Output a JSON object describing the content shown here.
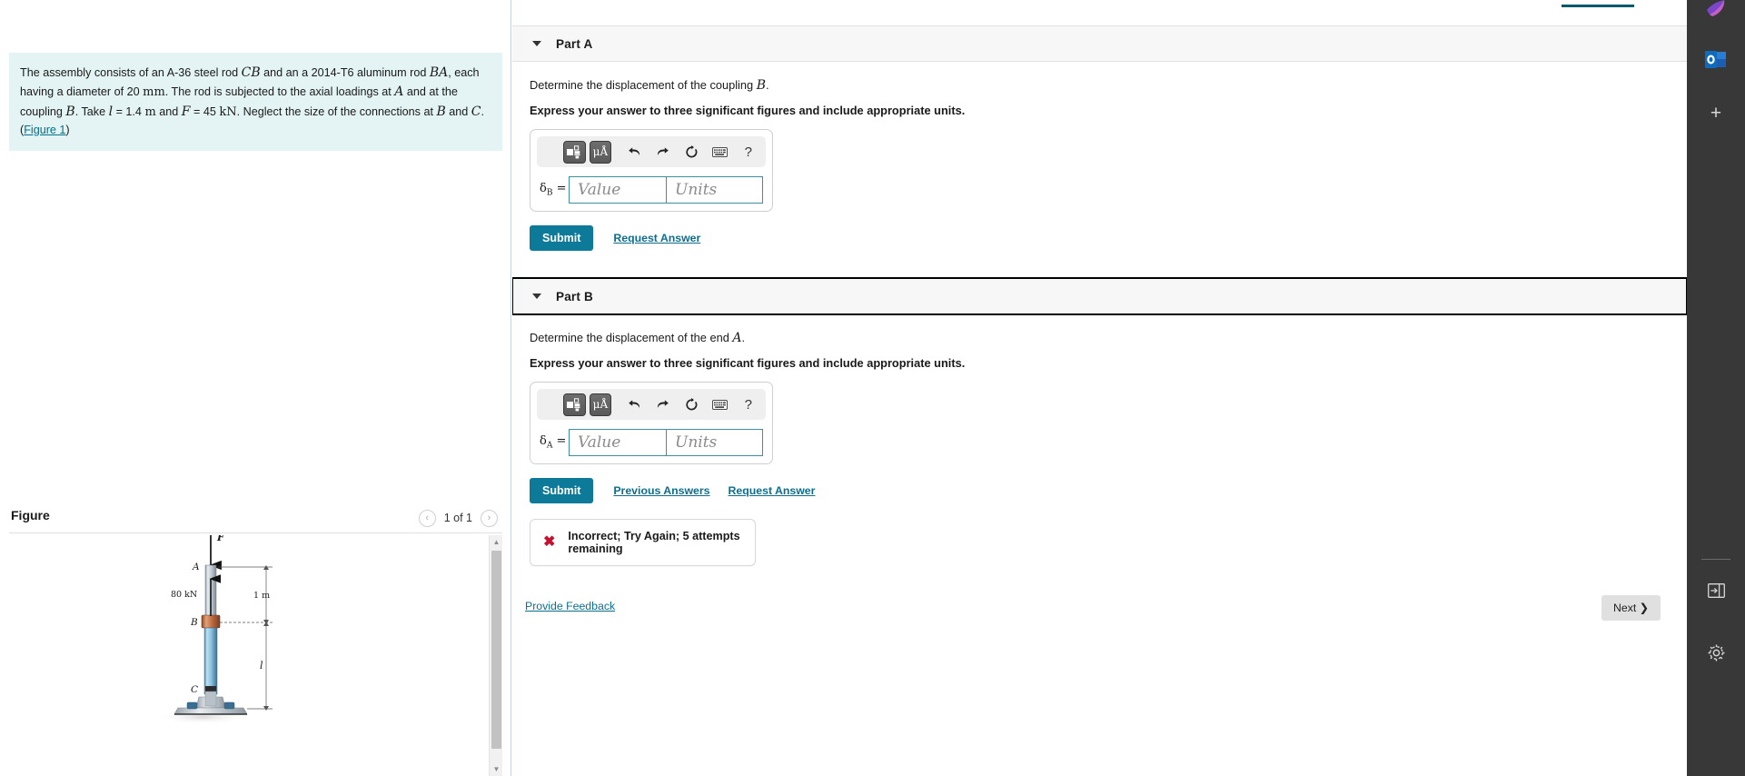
{
  "problem": {
    "text_1": "The assembly consists of an A-36 steel rod ",
    "rod_cb": "CB",
    "text_2": " and an a 2014-T6 aluminum rod ",
    "rod_ba": "BA",
    "text_3": ", each having a diameter of 20 ",
    "unit_mm": "mm",
    "text_4": ". The rod is subjected to the axial loadings at ",
    "point_a": "A",
    "text_5": " and at the coupling ",
    "point_b": "B",
    "text_6": ". Take ",
    "var_l": "l",
    "text_7": " = 1.4 ",
    "unit_m": "m",
    "text_8": " and ",
    "var_f": "F",
    "text_9": " = 45 ",
    "unit_kn": "kN",
    "text_10": ". Neglect the size of the connections at ",
    "point_b2": "B",
    "text_11": " and ",
    "point_c": "C",
    "text_12": ". (",
    "figure_link": "Figure 1",
    "text_13": ")"
  },
  "figure": {
    "title": "Figure",
    "pager_label": "1 of 1",
    "prev_arrow": "‹",
    "next_arrow": "›",
    "labels": {
      "force": "F",
      "point_a": "A",
      "point_b": "B",
      "point_c": "C",
      "load": "80 kN",
      "dim_top": "1 m",
      "dim_bottom": "l"
    }
  },
  "parts": [
    {
      "id": "part-a",
      "label": "Part A",
      "focused": false,
      "prompt": "Determine the displacement of the coupling ",
      "prompt_math": "B",
      "prompt_tail": ".",
      "instruction": "Express your answer to three significant figures and include appropriate units.",
      "symbol": "δ",
      "symbol_sub": "B",
      "symbol_eq": " =",
      "value_placeholder": "Value",
      "units_placeholder": "Units",
      "value": "",
      "units": "",
      "toolbar": {
        "template_button": "template-icon",
        "units_button": "μÅ",
        "undo": "↶",
        "redo": "↷",
        "reset": "↺",
        "keyboard": "keyboard-icon",
        "help": "?"
      },
      "submit_label": "Submit",
      "links": [
        "Request Answer"
      ],
      "feedback": null
    },
    {
      "id": "part-b",
      "label": "Part B",
      "focused": true,
      "prompt": "Determine the displacement of the end ",
      "prompt_math": "A",
      "prompt_tail": ".",
      "instruction": "Express your answer to three significant figures and include appropriate units.",
      "symbol": "δ",
      "symbol_sub": "A",
      "symbol_eq": " =",
      "value_placeholder": "Value",
      "units_placeholder": "Units",
      "value": "",
      "units": "",
      "toolbar": {
        "template_button": "template-icon",
        "units_button": "μÅ",
        "undo": "↶",
        "redo": "↷",
        "reset": "↺",
        "keyboard": "keyboard-icon",
        "help": "?"
      },
      "submit_label": "Submit",
      "links": [
        "Previous Answers",
        "Request Answer"
      ],
      "feedback": {
        "icon": "x-mark",
        "text": "Incorrect; Try Again; 5 attempts remaining"
      }
    }
  ],
  "footer": {
    "provide_feedback": "Provide Feedback",
    "next_label": "Next ❯"
  },
  "right_bar": {
    "items": [
      {
        "name": "onenote-icon"
      },
      {
        "name": "outlook-icon"
      },
      {
        "name": "add-app-icon",
        "glyph": "+"
      },
      {
        "name": "expand-panel-icon"
      },
      {
        "name": "settings-gear-icon"
      }
    ]
  },
  "colors": {
    "accent_teal": "#0d7a99",
    "link_blue": "#0d6e8c",
    "problem_bg": "#e4f3f3",
    "error_red": "#c8102e",
    "part_header_bg": "#f7f7f7",
    "right_bar_bg": "#383838"
  }
}
